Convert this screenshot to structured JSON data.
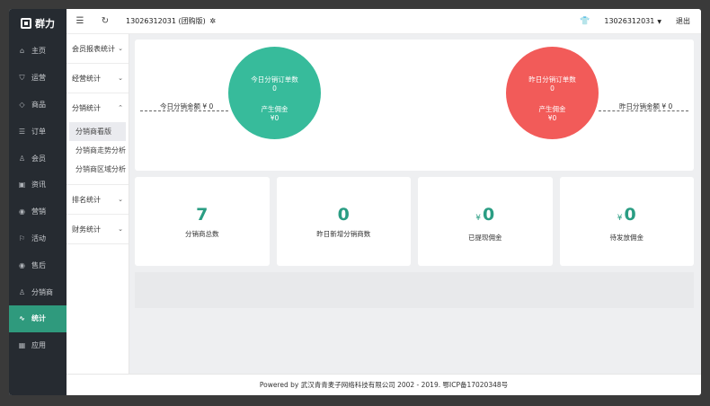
{
  "sidebar": {
    "logo_text": "群力",
    "items": [
      {
        "label": "主页",
        "icon": "home-icon",
        "glyph": "⌂"
      },
      {
        "label": "运营",
        "icon": "shield-check-icon",
        "glyph": "⛉"
      },
      {
        "label": "商品",
        "icon": "tag-icon",
        "glyph": "◇"
      },
      {
        "label": "订单",
        "icon": "list-icon",
        "glyph": "☰"
      },
      {
        "label": "会员",
        "icon": "member-icon",
        "glyph": "♙"
      },
      {
        "label": "资讯",
        "icon": "news-icon",
        "glyph": "▣"
      },
      {
        "label": "营销",
        "icon": "coin-icon",
        "glyph": "◉"
      },
      {
        "label": "活动",
        "icon": "flag-icon",
        "glyph": "⚐"
      },
      {
        "label": "售后",
        "icon": "coin-service-icon",
        "glyph": "◉"
      },
      {
        "label": "分销商",
        "icon": "user-icon",
        "glyph": "♙"
      },
      {
        "label": "统计",
        "icon": "pulse-icon",
        "glyph": "∿"
      },
      {
        "label": "应用",
        "icon": "app-icon",
        "glyph": "▦"
      }
    ],
    "active_index": 10
  },
  "submenu": {
    "groups": [
      {
        "label": "会员报表统计",
        "chevron": "⌄",
        "children": []
      },
      {
        "label": "经营统计",
        "chevron": "⌄",
        "children": []
      },
      {
        "label": "分销统计",
        "chevron": "⌃",
        "children": [
          "分销商看版",
          "分销商走势分析",
          "分销商区域分析"
        ]
      },
      {
        "label": "排名统计",
        "chevron": "⌄",
        "children": []
      },
      {
        "label": "财务统计",
        "chevron": "⌄",
        "children": []
      }
    ],
    "selected": "分销商看版"
  },
  "topbar": {
    "menu_glyph": "☰",
    "refresh_glyph": "↻",
    "shop_name": "13026312031 (团购版)",
    "gear_glyph": "✲",
    "shirt_glyph": "👕",
    "account": "13026312031",
    "caret": "▼",
    "logout": "退出"
  },
  "summary": {
    "today": {
      "orders_label": "今日分销订单数",
      "orders_value": "0",
      "commission_label": "产生佣金",
      "commission_value": "¥0",
      "amount_label": "今日分销金额 ¥ 0"
    },
    "yesterday": {
      "orders_label": "昨日分销订单数",
      "orders_value": "0",
      "commission_label": "产生佣金",
      "commission_value": "¥0",
      "amount_label": "昨日分销金额 ¥ 0"
    }
  },
  "stats": [
    {
      "currency": "",
      "value": "7",
      "label": "分销商总数"
    },
    {
      "currency": "",
      "value": "0",
      "label": "昨日新增分销商数"
    },
    {
      "currency": "¥",
      "value": "0",
      "label": "已提现佣金"
    },
    {
      "currency": "¥",
      "value": "0",
      "label": "待发放佣金"
    }
  ],
  "footer": {
    "text": "Powered by 武汉青青麦子网络科技有限公司 2002 - 2019. 鄂ICP备17020348号"
  },
  "colors": {
    "sidebar_bg": "#262b31",
    "accent": "#2f9a7d",
    "green_circle": "#37bb9b",
    "red_circle": "#f25b59",
    "stat_number": "#2a9d83"
  }
}
